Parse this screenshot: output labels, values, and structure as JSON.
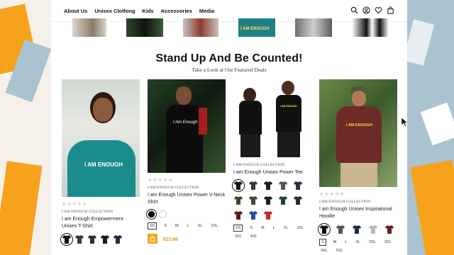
{
  "nav": {
    "items": [
      "About Us",
      "Unisex Clothing",
      "Kids",
      "Accessories",
      "Media"
    ],
    "icons": [
      "search-icon",
      "user-icon",
      "heart-icon",
      "cart-icon"
    ]
  },
  "thumb_text": "I AM ENOUGH",
  "section": {
    "title": "Stand Up And Be Counted!",
    "subtitle": "Take a Look at Our Featured Deals"
  },
  "products": [
    {
      "print": "I AM ENOUGH",
      "stars": "★★★★★",
      "collection": "I AM ENOUGH COLLECTION",
      "name": "I am Enough Empowerment Unisex T-Shirt",
      "swatches": [
        "#111111",
        "#3a3a3a",
        "#2b2f26",
        "#1a1a1a",
        "#1f2a44"
      ]
    },
    {
      "print": "I Am Enough",
      "stars": "★★★★★",
      "collection": "I AM ENOUGH COLLECTION",
      "name": "I am Enough Unisex Power V-Neck Shirt",
      "dots": [
        "#000000",
        "#ffffff"
      ],
      "sizes": [
        "XS",
        "S",
        "M",
        "L",
        "XL",
        "2XL"
      ],
      "price": "$23.00"
    },
    {
      "print": "I AM ENOUGH",
      "stars": "★★★★★",
      "collection": "I AM ENOUGH COLLECTION",
      "name": "I am Enough Unisex Power Tee",
      "swatches": [
        "#111111",
        "#3b3530",
        "#1c1c1c",
        "#4f5b50",
        "#2c3347",
        "#3b4a2e",
        "#4a4332",
        "#1e1e1e",
        "#21402e",
        "#26302a",
        "#5a1b1b",
        "#1f4e9c",
        "#c92727"
      ],
      "sizes": [
        "XS",
        "S",
        "M",
        "L",
        "XL",
        "2XL",
        "3XL",
        "4XL"
      ]
    },
    {
      "print": "I AM ENOUGH",
      "stars": "★★★★★",
      "collection": "I AM ENOUGH COLLECTION",
      "name": "I am Enough Unisex Inspirational Hoodie",
      "swatches": [
        "#0d0d0d",
        "#555555",
        "#1b2a44",
        "#b8b8b8",
        "#6b1f22"
      ],
      "sizes": [
        "S",
        "M",
        "L",
        "XL",
        "2XL",
        "3XL",
        "4XL",
        "5XL"
      ]
    }
  ]
}
